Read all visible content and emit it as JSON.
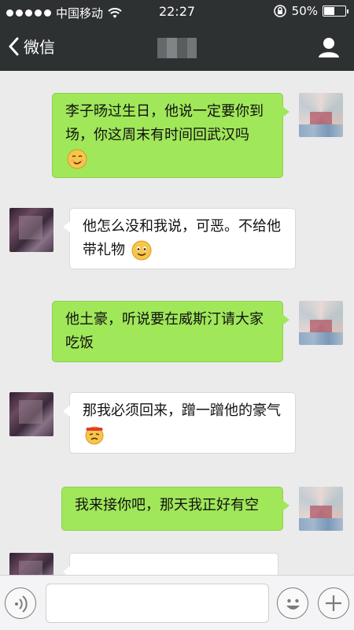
{
  "status_bar": {
    "carrier": "中国移动",
    "time": "22:27",
    "battery_percent": "50%",
    "battery_level": 0.5,
    "signal_bars": 5,
    "icons": [
      "signal-dots-icon",
      "wifi-icon",
      "rotation-lock-icon",
      "battery-icon"
    ]
  },
  "nav": {
    "back_label": "微信",
    "title": "",
    "icons": [
      "chevron-left-icon",
      "profile-icon"
    ]
  },
  "messages": [
    {
      "sender": "me",
      "text": "李子旸过生日，他说一定要你到场，你这周末有时间回武汉吗",
      "emoji": "smirk-emoji"
    },
    {
      "sender": "them",
      "text": "他怎么没和我说，可恶。不给他带礼物",
      "emoji": "smile-emoji"
    },
    {
      "sender": "me",
      "text": "他土豪，听说要在威斯汀请大家吃饭",
      "emoji": ""
    },
    {
      "sender": "them",
      "text": "那我必须回来，蹭一蹭他的豪气",
      "emoji": "sweat-headband-emoji"
    },
    {
      "sender": "me",
      "text": "我来接你吧，那天我正好有空",
      "emoji": ""
    },
    {
      "sender": "them",
      "text": "",
      "emoji": ""
    }
  ],
  "input_bar": {
    "placeholder": "",
    "icons": [
      "voice-icon",
      "emoji-icon",
      "plus-icon"
    ]
  },
  "colors": {
    "header_bg": "#2e3132",
    "chat_bg": "#ebebeb",
    "my_bubble": "#a0e75a",
    "their_bubble": "#ffffff"
  }
}
